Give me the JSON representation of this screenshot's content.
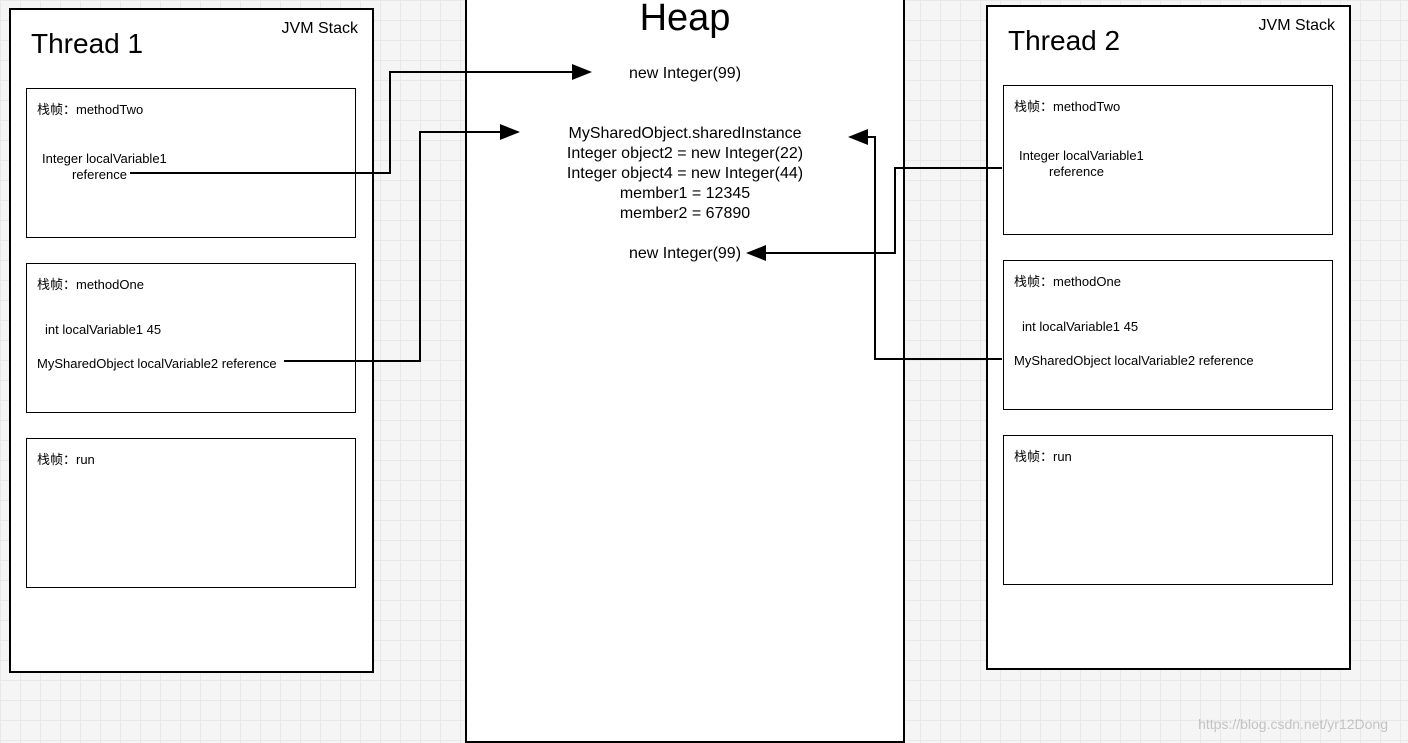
{
  "thread1": {
    "title": "Thread 1",
    "jvm": "JVM Stack",
    "frame1": {
      "label": "栈帧：methodTwo",
      "var1": "Integer localVariable1",
      "var1ref": "reference"
    },
    "frame2": {
      "label": "栈帧：methodOne",
      "var1": "int localVariable1   45",
      "var2": "MySharedObject localVariable2 reference"
    },
    "frame3": {
      "label": "栈帧：run"
    }
  },
  "thread2": {
    "title": "Thread 2",
    "jvm": "JVM Stack",
    "frame1": {
      "label": "栈帧：methodTwo",
      "var1": "Integer localVariable1",
      "var1ref": "reference"
    },
    "frame2": {
      "label": "栈帧：methodOne",
      "var1": "int localVariable1   45",
      "var2": "MySharedObject localVariable2 reference"
    },
    "frame3": {
      "label": "栈帧：run"
    }
  },
  "heap": {
    "title": "Heap",
    "line1": "new Integer(99)",
    "line2": "MySharedObject.sharedInstance",
    "line3": "Integer object2 = new Integer(22)",
    "line4": "Integer object4 = new Integer(44)",
    "line5": "member1 = 12345",
    "line6": "member2 = 67890",
    "line7": "new Integer(99)"
  },
  "watermark": "https://blog.csdn.net/yr12Dong"
}
